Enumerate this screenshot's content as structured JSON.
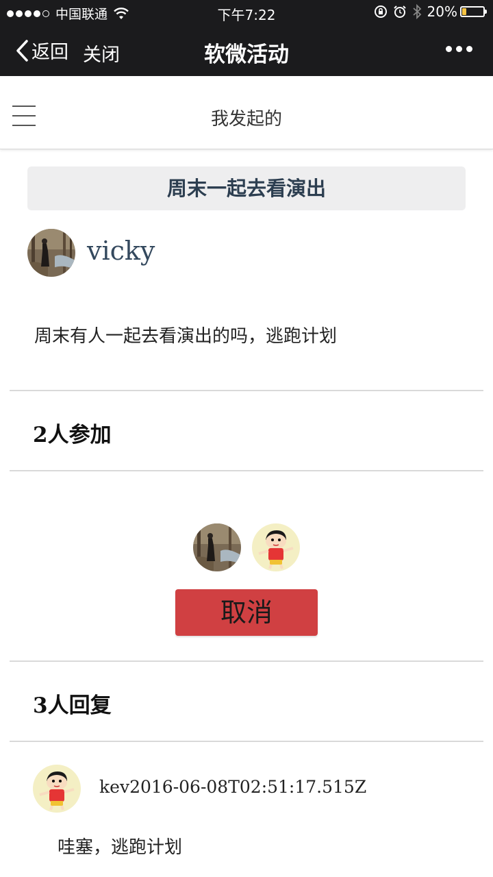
{
  "status_bar": {
    "carrier": "中国联通",
    "time": "下午7:22",
    "battery": "20%",
    "battery_level": 0.2
  },
  "nav": {
    "back_label": "返回",
    "close_label": "关闭",
    "title": "软微活动"
  },
  "header": {
    "title": "我发起的"
  },
  "activity": {
    "title": "周末一起去看演出",
    "author": "vicky",
    "body": "周末有人一起去看演出的吗，逃跑计划"
  },
  "participants": {
    "heading": "2人参加",
    "cancel_label": "取消"
  },
  "replies": {
    "heading": "3人回复",
    "items": [
      {
        "meta": "kev2016-06-08T02:51:17.515Z",
        "text": "哇塞，逃跑计划"
      }
    ]
  },
  "colors": {
    "bar_bg": "#1b1b1d",
    "cancel_button": "#d04042",
    "title_box": "#eeeeef",
    "battery_fill": "#f6c443"
  }
}
